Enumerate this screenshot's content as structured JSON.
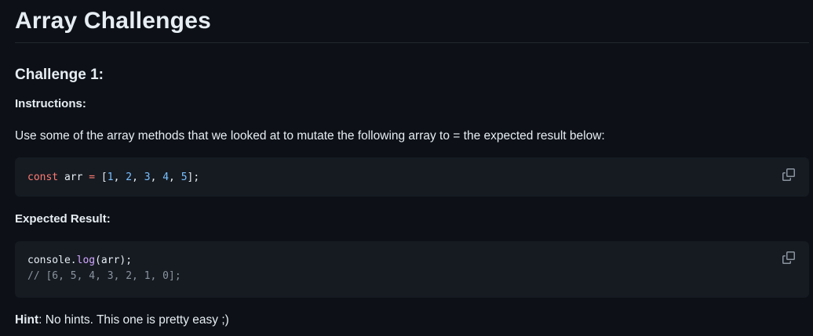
{
  "title": "Array Challenges",
  "challenge_heading": "Challenge 1:",
  "instructions_label": "Instructions:",
  "instructions_text": "Use some of the array methods that we looked at to mutate the following array to = the expected result below:",
  "code1": {
    "kw": "const",
    "ident": " arr ",
    "op": "=",
    "open": " [",
    "n1": "1",
    "sep1": ", ",
    "n2": "2",
    "sep2": ", ",
    "n3": "3",
    "sep3": ", ",
    "n4": "4",
    "sep4": ", ",
    "n5": "5",
    "close": "];"
  },
  "expected_label": "Expected Result:",
  "code2": {
    "obj": "console.",
    "fn": "log",
    "args": "(arr);",
    "comment": "// [6, 5, 4, 3, 2, 1, 0];"
  },
  "hint": {
    "label": "Hint",
    "colon": ":",
    "text": " No hints. This one is pretty easy ;)"
  },
  "icons": {
    "copy1": "copy-icon",
    "copy2": "copy-icon"
  },
  "colors": {
    "background": "#0d1117",
    "code_background": "#161b22",
    "keyword": "#ff7b72",
    "number": "#79c0ff",
    "function": "#d2a8ff",
    "comment": "#8b949e"
  }
}
